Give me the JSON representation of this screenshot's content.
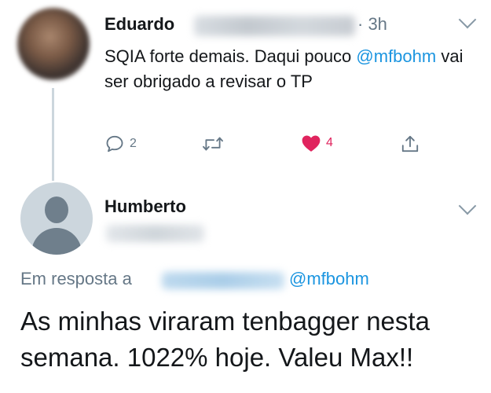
{
  "tweet1": {
    "author": "Eduardo",
    "time": "· 3h",
    "text_before": "SQIA forte demais. Daqui pouco ",
    "mention": "@mfbohm",
    "text_after": " vai ser obrigado a revisar o TP",
    "actions": {
      "replies": "2",
      "retweets": "",
      "likes": "4"
    }
  },
  "tweet2": {
    "author": "Humberto",
    "reply_prefix": "Em resposta a",
    "reply_mention": "@mfbohm",
    "text": "As minhas viraram tenbagger nesta semana. 1022% hoje. Valeu Max!!"
  },
  "colors": {
    "accent": "#1b95e0",
    "like": "#e0245e",
    "secondary_text": "#657786",
    "thread_line": "#ccd6dd"
  },
  "icons": {
    "reply": "reply-icon",
    "retweet": "retweet-icon",
    "like": "heart-icon",
    "share": "share-icon",
    "menu": "chevron-down-icon"
  }
}
